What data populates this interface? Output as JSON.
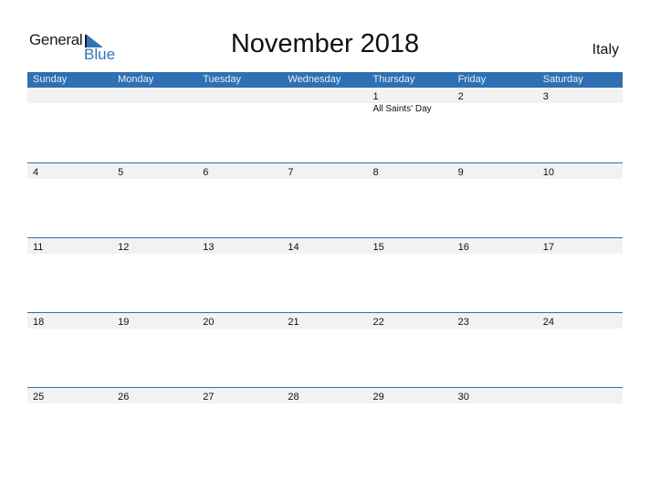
{
  "brand": {
    "general": "General",
    "blue": "Blue"
  },
  "title": "November 2018",
  "country": "Italy",
  "colors": {
    "header": "#2e70b3",
    "strip": "#f2f2f2",
    "brand_blue": "#2f75b5"
  },
  "weekdays": [
    "Sunday",
    "Monday",
    "Tuesday",
    "Wednesday",
    "Thursday",
    "Friday",
    "Saturday"
  ],
  "weeks": [
    {
      "days": [
        {
          "num": "",
          "event": ""
        },
        {
          "num": "",
          "event": ""
        },
        {
          "num": "",
          "event": ""
        },
        {
          "num": "",
          "event": ""
        },
        {
          "num": "1",
          "event": "All Saints' Day"
        },
        {
          "num": "2",
          "event": ""
        },
        {
          "num": "3",
          "event": ""
        }
      ]
    },
    {
      "days": [
        {
          "num": "4",
          "event": ""
        },
        {
          "num": "5",
          "event": ""
        },
        {
          "num": "6",
          "event": ""
        },
        {
          "num": "7",
          "event": ""
        },
        {
          "num": "8",
          "event": ""
        },
        {
          "num": "9",
          "event": ""
        },
        {
          "num": "10",
          "event": ""
        }
      ]
    },
    {
      "days": [
        {
          "num": "11",
          "event": ""
        },
        {
          "num": "12",
          "event": ""
        },
        {
          "num": "13",
          "event": ""
        },
        {
          "num": "14",
          "event": ""
        },
        {
          "num": "15",
          "event": ""
        },
        {
          "num": "16",
          "event": ""
        },
        {
          "num": "17",
          "event": ""
        }
      ]
    },
    {
      "days": [
        {
          "num": "18",
          "event": ""
        },
        {
          "num": "19",
          "event": ""
        },
        {
          "num": "20",
          "event": ""
        },
        {
          "num": "21",
          "event": ""
        },
        {
          "num": "22",
          "event": ""
        },
        {
          "num": "23",
          "event": ""
        },
        {
          "num": "24",
          "event": ""
        }
      ]
    },
    {
      "days": [
        {
          "num": "25",
          "event": ""
        },
        {
          "num": "26",
          "event": ""
        },
        {
          "num": "27",
          "event": ""
        },
        {
          "num": "28",
          "event": ""
        },
        {
          "num": "29",
          "event": ""
        },
        {
          "num": "30",
          "event": ""
        },
        {
          "num": "",
          "event": ""
        }
      ]
    }
  ]
}
